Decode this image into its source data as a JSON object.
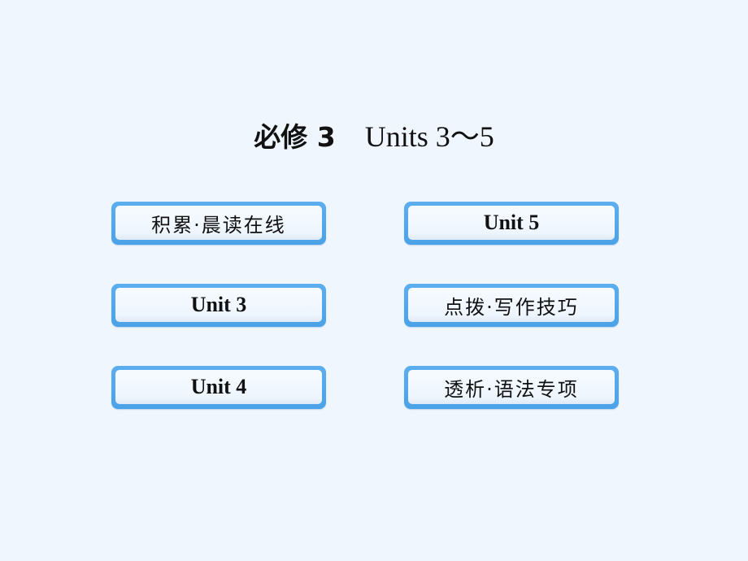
{
  "title": {
    "module": "必修 3",
    "units": "Units 3～5"
  },
  "buttons": [
    {
      "label": "积累·晨读在线",
      "lang": "cn"
    },
    {
      "label": "Unit 5",
      "lang": "en"
    },
    {
      "label": "Unit 3",
      "lang": "en"
    },
    {
      "label": "点拨·写作技巧",
      "lang": "cn"
    },
    {
      "label": "Unit 4",
      "lang": "en"
    },
    {
      "label": "透析·语法专项",
      "lang": "cn"
    }
  ],
  "colors": {
    "background": "#eff6fe",
    "button_border": "#5caeee",
    "button_fill": "#f6fbff",
    "text": "#111111"
  }
}
